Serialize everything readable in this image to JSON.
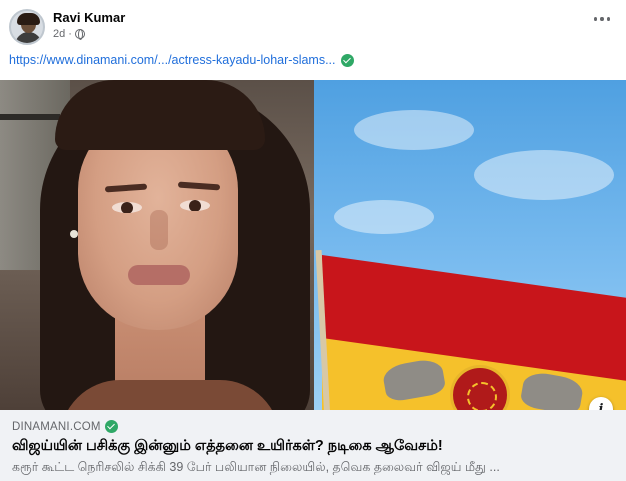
{
  "post": {
    "author": "Ravi Kumar",
    "time": "2d",
    "visibility_icon": "globe-icon",
    "more_icon": "more-options-icon",
    "link_url": "https://www.dinamani.com/.../actress-kayadu-lohar-slams...",
    "verified_icon": "verified-check-icon"
  },
  "link_preview": {
    "domain": "DINAMANI.COM",
    "headline": "விஜய்யின் பசிக்கு இன்னும் எத்தனை உயிர்கள்? நடிகை ஆவேசம்!",
    "description": "கரூர் கூட்ட நெரிசலில் சிக்கி 39 பேர் பலியான நிலையில், தவெக தலைவர் விஜய் மீது ...",
    "info_label": "i"
  },
  "colors": {
    "link_blue": "#216fdb",
    "verified_green": "#2fa866",
    "card_bg": "#f0f2f5",
    "secondary_text": "#65676b"
  }
}
